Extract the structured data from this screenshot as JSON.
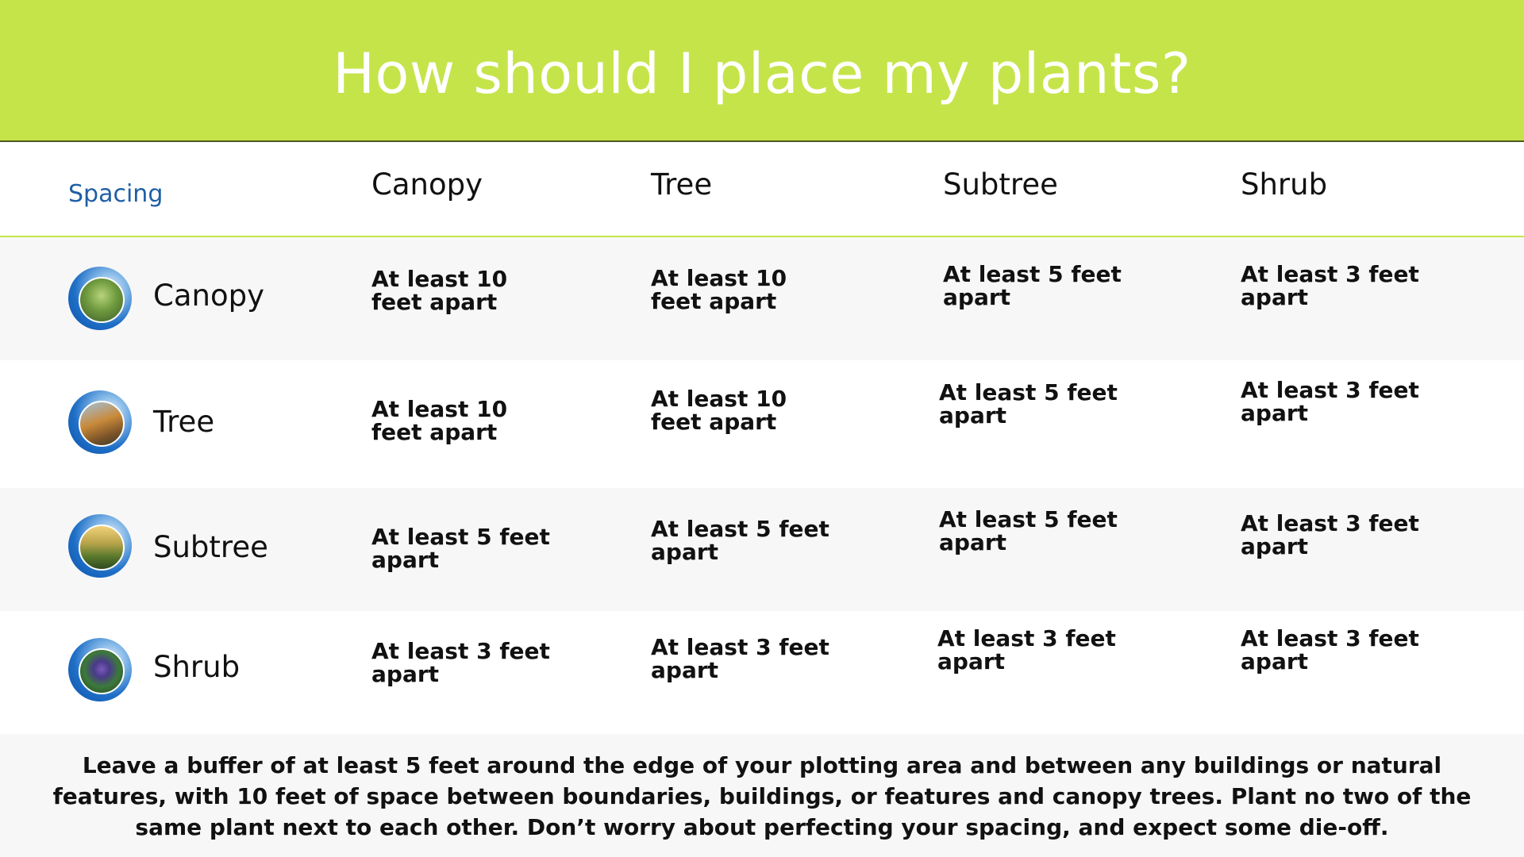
{
  "title": "How should I place my plants?",
  "spacing_label": "Spacing",
  "columns": [
    "Canopy",
    "Tree",
    "Subtree",
    "Shrub"
  ],
  "rows": [
    {
      "name": "Canopy",
      "icon": "canopy-photo-icon",
      "cells": [
        "At least 10 feet apart",
        "At least 10 feet apart",
        "At least 5 feet apart",
        "At least 3 feet apart"
      ]
    },
    {
      "name": "Tree",
      "icon": "tree-photo-icon",
      "cells": [
        "At least 10 feet apart",
        "At least 10 feet apart",
        "At least 5 feet apart",
        "At least 3 feet apart"
      ]
    },
    {
      "name": "Subtree",
      "icon": "subtree-photo-icon",
      "cells": [
        "At least 5 feet apart",
        "At least 5 feet apart",
        "At least 5 feet apart",
        "At least 3 feet apart"
      ]
    },
    {
      "name": "Shrub",
      "icon": "shrub-photo-icon",
      "cells": [
        "At least 3 feet apart",
        "At least 3 feet apart",
        "At least 3 feet apart",
        "At least 3 feet apart"
      ]
    }
  ],
  "footer": "Leave a buffer of at least 5 feet around the edge of your plotting area and between any buildings or natural features, with 10 feet of space between boundaries, buildings, or features and canopy trees. Plant no two of the same plant next to each other. Don’t worry about perfecting your spacing, and expect some die-off.",
  "colors": {
    "header_bg": "#c5e44a",
    "header_text": "#ffffff",
    "spacing_label": "#1f5fa6",
    "row_alt_bg": "#f7f7f7",
    "icon_ring": "#1f6fc7"
  }
}
